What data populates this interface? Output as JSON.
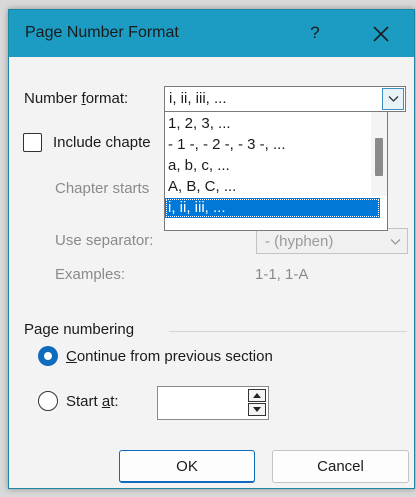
{
  "window": {
    "title": "Page Number Format",
    "help": "?"
  },
  "number_format": {
    "label_before": "Number ",
    "label_underlined": "f",
    "label_after": "ormat:",
    "value": "i, ii, iii, ...",
    "options": [
      "1, 2, 3, ...",
      "- 1 -, - 2 -, - 3 -, ...",
      "a, b, c, ...",
      "A, B, C, ...",
      "i, ii, iii, ..."
    ],
    "selected_index": 4
  },
  "chapter": {
    "include_label": "Include chapte",
    "starts_label": "Chapter starts",
    "separator_label": "Use separator:",
    "separator_value": "-   (hyphen)",
    "examples_label": "Examples:",
    "examples_value": "1-1, 1-A"
  },
  "page_numbering": {
    "heading": "Page numbering",
    "continue_underlined": "C",
    "continue_rest": "ontinue from previous section",
    "start_before": "Start ",
    "start_underlined": "a",
    "start_after": "t:",
    "start_value": ""
  },
  "buttons": {
    "ok": "OK",
    "cancel": "Cancel"
  },
  "colors": {
    "title_bar": "#1c9cc2",
    "accent": "#0f6cbd",
    "selection": "#0078d7"
  }
}
